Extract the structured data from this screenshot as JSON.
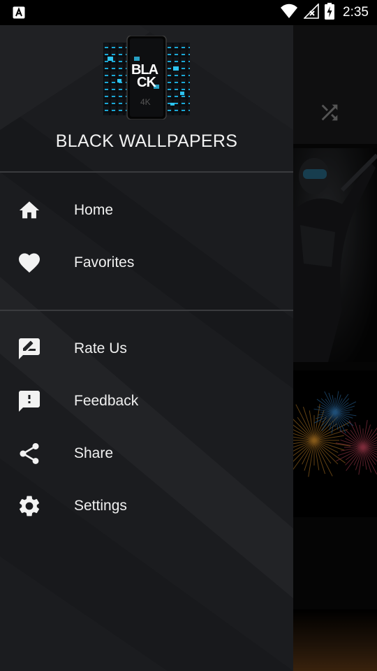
{
  "status_bar": {
    "time": "2:35",
    "icons": [
      "a-notification-icon",
      "wifi-icon",
      "no-signal-icon",
      "battery-charging-icon"
    ]
  },
  "drawer": {
    "logo": {
      "line1": "BLA",
      "line2": "CK",
      "badge": "4K"
    },
    "title": "BLACK WALLPAPERS",
    "sections": [
      {
        "items": [
          {
            "label": "Home",
            "icon": "home-icon"
          },
          {
            "label": "Favorites",
            "icon": "heart-icon"
          }
        ]
      },
      {
        "items": [
          {
            "label": "Rate Us",
            "icon": "rate-review-icon"
          },
          {
            "label": "Feedback",
            "icon": "feedback-icon"
          },
          {
            "label": "Share",
            "icon": "share-icon"
          },
          {
            "label": "Settings",
            "icon": "settings-gear-icon"
          }
        ]
      }
    ]
  },
  "background_app": {
    "toolbar_action": "shuffle-icon"
  },
  "colors": {
    "drawer_bg": "#1b1c1f",
    "divider": "#3a3b3e",
    "text": "#f0f0f0",
    "accent": "#2ec4f0"
  }
}
